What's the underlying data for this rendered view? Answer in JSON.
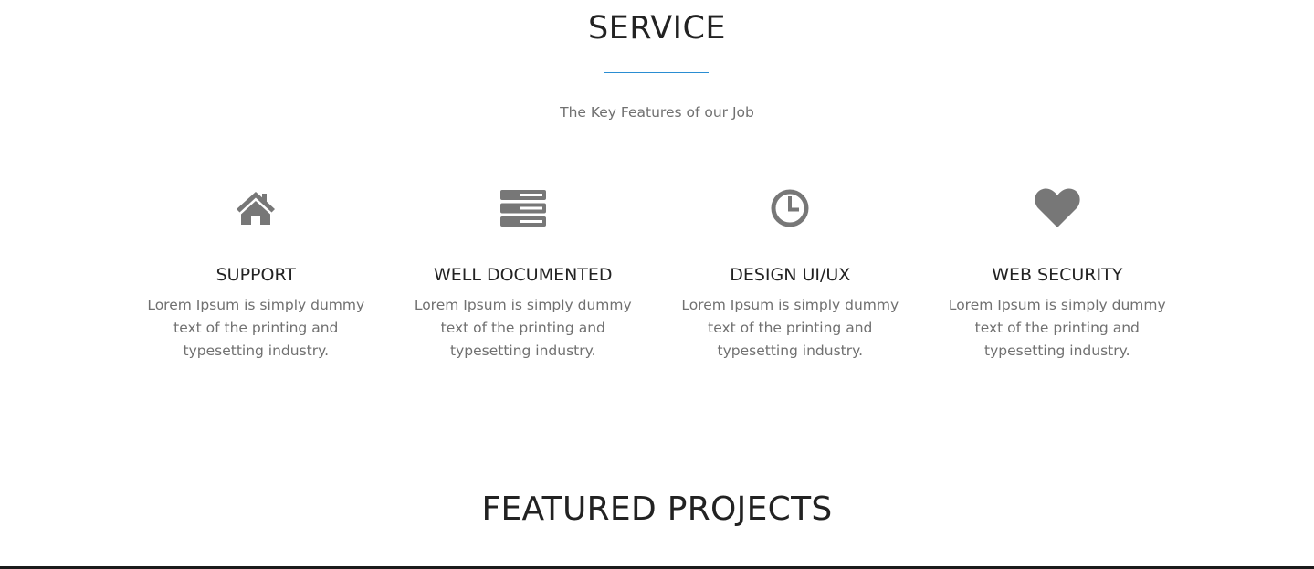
{
  "service": {
    "title": "SERVICE",
    "subtitle": "The Key Features of our Job"
  },
  "features": [
    {
      "icon": "home-icon",
      "title": "SUPPORT",
      "text": "Lorem Ipsum is simply dummy text of the printing and typesetting industry."
    },
    {
      "icon": "server-icon",
      "title": "WELL DOCUMENTED",
      "text": "Lorem Ipsum is simply dummy text of the printing and typesetting industry."
    },
    {
      "icon": "clock-icon",
      "title": "DESIGN UI/UX",
      "text": "Lorem Ipsum is simply dummy text of the printing and typesetting industry."
    },
    {
      "icon": "heart-icon",
      "title": "WEB SECURITY",
      "text": "Lorem Ipsum is simply dummy text of the printing and typesetting industry."
    }
  ],
  "featured_projects": {
    "title": "FEATURED PROJECTS"
  },
  "colors": {
    "accent": "#2a8dd2",
    "icon": "#777777",
    "heading": "#222222",
    "body_text": "#707070"
  }
}
